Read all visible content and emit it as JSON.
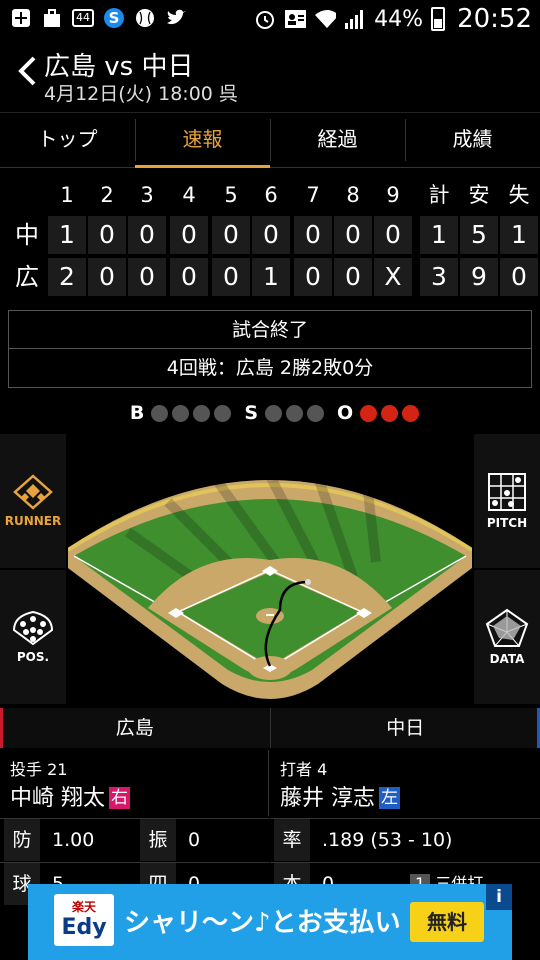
{
  "status_bar": {
    "box_icon_label": "44",
    "battery": "44%",
    "time": "20:52"
  },
  "header": {
    "title": "広島 vs 中日",
    "subtitle": "4月12日(火) 18:00 呉"
  },
  "tabs": [
    {
      "label": "トップ",
      "active": false
    },
    {
      "label": "速報",
      "active": true
    },
    {
      "label": "経過",
      "active": false
    },
    {
      "label": "成績",
      "active": false
    }
  ],
  "scoreboard": {
    "innings": [
      "1",
      "2",
      "3",
      "4",
      "5",
      "6",
      "7",
      "8",
      "9"
    ],
    "totals_headers": [
      "計",
      "安",
      "失"
    ],
    "rows": [
      {
        "team": "中",
        "scores": [
          "1",
          "0",
          "0",
          "0",
          "0",
          "0",
          "0",
          "0",
          "0"
        ],
        "totals": [
          "1",
          "5",
          "1"
        ]
      },
      {
        "team": "広",
        "scores": [
          "2",
          "0",
          "0",
          "0",
          "0",
          "1",
          "0",
          "0",
          "X"
        ],
        "totals": [
          "3",
          "9",
          "0"
        ]
      }
    ]
  },
  "game_status": {
    "line1": "試合終了",
    "line2": "4回戦：広島 2勝2敗0分"
  },
  "bso": {
    "b_label": "B",
    "balls": 0,
    "balls_max": 4,
    "s_label": "S",
    "strikes": 0,
    "strikes_max": 3,
    "o_label": "O",
    "outs": 3,
    "outs_max": 3
  },
  "field": {
    "runner_label": "RUNNER",
    "pitch_label": "PITCH",
    "pos_label": "POS.",
    "data_label": "DATA"
  },
  "teams": {
    "home": "広島",
    "away": "中日"
  },
  "pitcher": {
    "role": "投手 21",
    "name": "中崎 翔太",
    "hand": "右",
    "stats": [
      {
        "label": "防",
        "value": "1.00"
      },
      {
        "label": "振",
        "value": "0"
      },
      {
        "label": "球",
        "value": "5"
      },
      {
        "label": "四",
        "value": "0"
      }
    ]
  },
  "batter": {
    "role": "打者 4",
    "name": "藤井 淳志",
    "hand": "左",
    "stats": [
      {
        "label": "率",
        "value": ".189 (53 - 10)"
      },
      {
        "label": "本",
        "value": "0"
      }
    ],
    "at_bat_no": "1",
    "at_bat_result": "三併打"
  },
  "ad": {
    "logo_top": "楽天",
    "logo_main": "Edy",
    "text": "シャリ〜ン♪とお支払い",
    "button": "無料",
    "info": "i"
  },
  "colors": {
    "accent": "#e8a33d",
    "out_dot": "#d32414",
    "home_team": "#c8192d",
    "away_team": "#1e5bb8",
    "right_hand": "#d6176b",
    "left_hand": "#1f5ec2",
    "ad_bg": "#21a0e8"
  }
}
